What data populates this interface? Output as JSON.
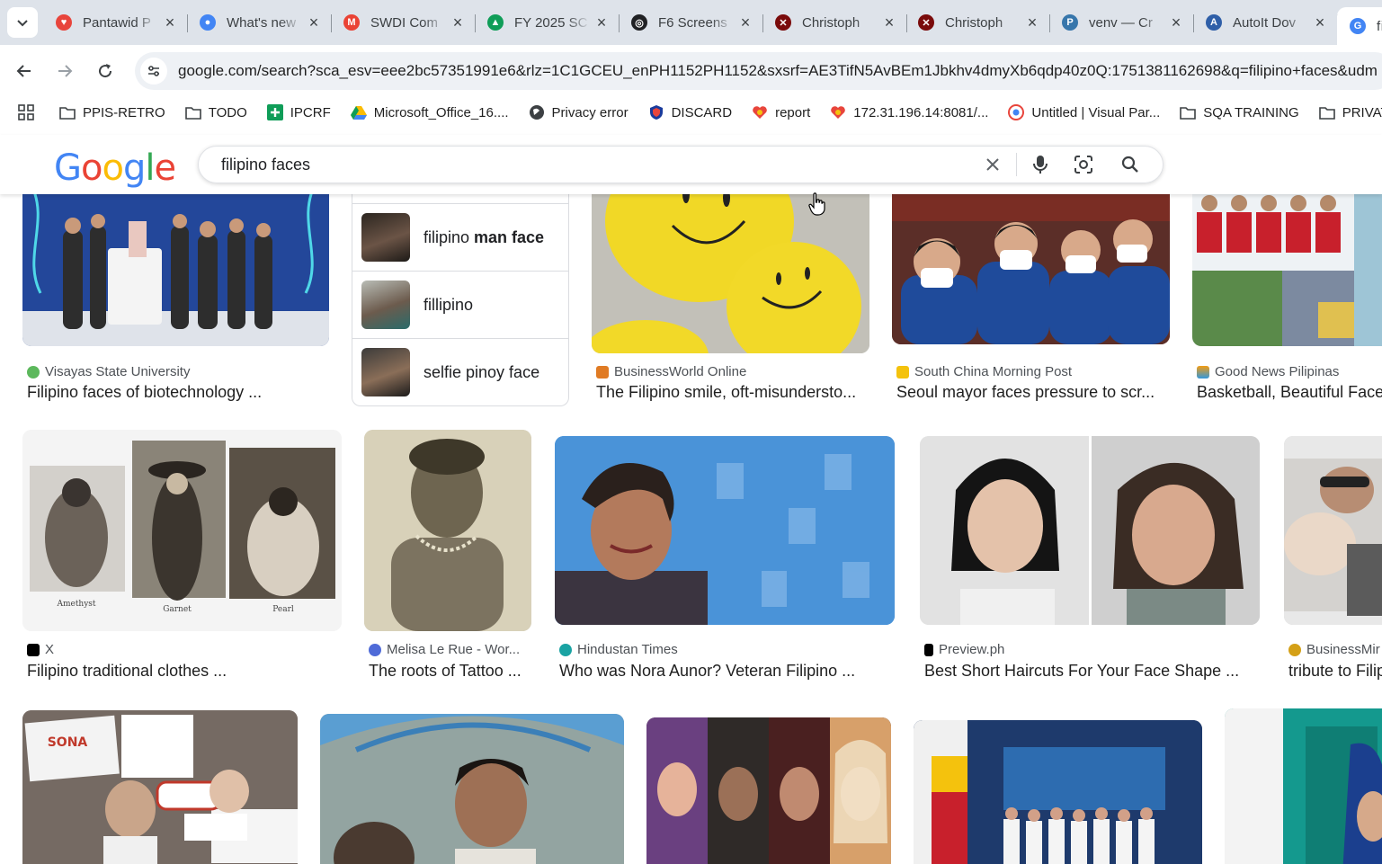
{
  "tabs": [
    {
      "title": "Pantawid P",
      "fav_color": "#e8453c",
      "fav_char": "♥"
    },
    {
      "title": "What's new",
      "fav_color": "#4285f4",
      "fav_char": "●"
    },
    {
      "title": "SWDI Com",
      "fav_color": "#ea4335",
      "fav_char": "M"
    },
    {
      "title": "FY 2025 SC",
      "fav_color": "#0f9d58",
      "fav_char": "▲"
    },
    {
      "title": "F6 Screens",
      "fav_color": "#202124",
      "fav_char": "◎"
    },
    {
      "title": "Christoph",
      "fav_color": "#7a0b0b",
      "fav_char": "✕"
    },
    {
      "title": "Christoph",
      "fav_color": "#7a0b0b",
      "fav_char": "✕"
    },
    {
      "title": "venv — Cr",
      "fav_color": "#3776ab",
      "fav_char": "P"
    },
    {
      "title": "AutoIt Dov",
      "fav_color": "#2f5fa8",
      "fav_char": "A"
    },
    {
      "title": "fi",
      "fav_color": "#4285f4",
      "fav_char": "G"
    }
  ],
  "toolbar": {
    "url": "google.com/search?sca_esv=eee2bc57351991e6&rlz=1C1GCEU_enPH1152PH1152&sxsrf=AE3TifN5AvBEm1Jbkhv4dmyXb6qdp40z0Q:1751381162698&q=filipino+faces&udm"
  },
  "bookmarks": [
    {
      "label": "PPIS-RETRO",
      "icon": "folder-icon"
    },
    {
      "label": "TODO",
      "icon": "folder-icon"
    },
    {
      "label": "IPCRF",
      "icon": "plus-icon"
    },
    {
      "label": "Microsoft_Office_16....",
      "icon": "drive-icon"
    },
    {
      "label": "Privacy error",
      "icon": "globe-icon"
    },
    {
      "label": "DISCARD",
      "icon": "shield-icon"
    },
    {
      "label": "report",
      "icon": "heart-icon"
    },
    {
      "label": "172.31.196.14:8081/...",
      "icon": "heart-icon"
    },
    {
      "label": "Untitled | Visual Par...",
      "icon": "visual-icon"
    },
    {
      "label": "SQA TRAINING",
      "icon": "folder-icon"
    },
    {
      "label": "PRIVATE",
      "icon": "folder-icon"
    }
  ],
  "search": {
    "query": "filipino faces"
  },
  "logo": {
    "letters": [
      "G",
      "o",
      "o",
      "g",
      "l",
      "e"
    ],
    "colors": [
      "#4285f4",
      "#ea4335",
      "#fbbc05",
      "#4285f4",
      "#34a853",
      "#ea4335"
    ]
  },
  "related": [
    {
      "prefix": "filipino ",
      "bold": "man face",
      "suffix": ""
    },
    {
      "prefix": "fillipino",
      "bold": "",
      "suffix": ""
    },
    {
      "prefix": "selfie pinoy face",
      "bold": "",
      "suffix": ""
    }
  ],
  "results": {
    "row1": [
      {
        "source": "Visayas State University",
        "title": "Filipino faces of biotechnology ..."
      },
      {
        "source": "BusinessWorld Online",
        "title": "The Filipino smile, oft-misundersto..."
      },
      {
        "source": "South China Morning Post",
        "title": "Seoul mayor faces pressure to scr..."
      },
      {
        "source": "Good News Pilipinas",
        "title": "Basketball, Beautiful Face"
      }
    ],
    "row2": [
      {
        "source": "X",
        "title": "Filipino traditional clothes ..."
      },
      {
        "source": "Melisa Le Rue - Wor...",
        "title": "The roots of Tattoo ..."
      },
      {
        "source": "Hindustan Times",
        "title": "Who was Nora Aunor? Veteran Filipino ..."
      },
      {
        "source": "Preview.ph",
        "title": "Best Short Haircuts For Your Face Shape ..."
      },
      {
        "source": "BusinessMir",
        "title": "tribute to Filip"
      }
    ],
    "image_captions": {
      "amethyst": "Amethyst",
      "garnet": "Garnet",
      "pearl": "Pearl"
    }
  }
}
